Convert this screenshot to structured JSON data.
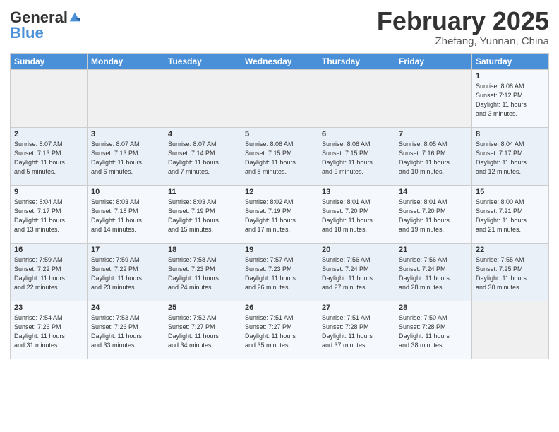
{
  "header": {
    "logo_general": "General",
    "logo_blue": "Blue",
    "month_title": "February 2025",
    "location": "Zhefang, Yunnan, China"
  },
  "days_of_week": [
    "Sunday",
    "Monday",
    "Tuesday",
    "Wednesday",
    "Thursday",
    "Friday",
    "Saturday"
  ],
  "weeks": [
    [
      {
        "day": "",
        "info": ""
      },
      {
        "day": "",
        "info": ""
      },
      {
        "day": "",
        "info": ""
      },
      {
        "day": "",
        "info": ""
      },
      {
        "day": "",
        "info": ""
      },
      {
        "day": "",
        "info": ""
      },
      {
        "day": "1",
        "info": "Sunrise: 8:08 AM\nSunset: 7:12 PM\nDaylight: 11 hours\nand 3 minutes."
      }
    ],
    [
      {
        "day": "2",
        "info": "Sunrise: 8:07 AM\nSunset: 7:13 PM\nDaylight: 11 hours\nand 5 minutes."
      },
      {
        "day": "3",
        "info": "Sunrise: 8:07 AM\nSunset: 7:13 PM\nDaylight: 11 hours\nand 6 minutes."
      },
      {
        "day": "4",
        "info": "Sunrise: 8:07 AM\nSunset: 7:14 PM\nDaylight: 11 hours\nand 7 minutes."
      },
      {
        "day": "5",
        "info": "Sunrise: 8:06 AM\nSunset: 7:15 PM\nDaylight: 11 hours\nand 8 minutes."
      },
      {
        "day": "6",
        "info": "Sunrise: 8:06 AM\nSunset: 7:15 PM\nDaylight: 11 hours\nand 9 minutes."
      },
      {
        "day": "7",
        "info": "Sunrise: 8:05 AM\nSunset: 7:16 PM\nDaylight: 11 hours\nand 10 minutes."
      },
      {
        "day": "8",
        "info": "Sunrise: 8:04 AM\nSunset: 7:17 PM\nDaylight: 11 hours\nand 12 minutes."
      }
    ],
    [
      {
        "day": "9",
        "info": "Sunrise: 8:04 AM\nSunset: 7:17 PM\nDaylight: 11 hours\nand 13 minutes."
      },
      {
        "day": "10",
        "info": "Sunrise: 8:03 AM\nSunset: 7:18 PM\nDaylight: 11 hours\nand 14 minutes."
      },
      {
        "day": "11",
        "info": "Sunrise: 8:03 AM\nSunset: 7:19 PM\nDaylight: 11 hours\nand 15 minutes."
      },
      {
        "day": "12",
        "info": "Sunrise: 8:02 AM\nSunset: 7:19 PM\nDaylight: 11 hours\nand 17 minutes."
      },
      {
        "day": "13",
        "info": "Sunrise: 8:01 AM\nSunset: 7:20 PM\nDaylight: 11 hours\nand 18 minutes."
      },
      {
        "day": "14",
        "info": "Sunrise: 8:01 AM\nSunset: 7:20 PM\nDaylight: 11 hours\nand 19 minutes."
      },
      {
        "day": "15",
        "info": "Sunrise: 8:00 AM\nSunset: 7:21 PM\nDaylight: 11 hours\nand 21 minutes."
      }
    ],
    [
      {
        "day": "16",
        "info": "Sunrise: 7:59 AM\nSunset: 7:22 PM\nDaylight: 11 hours\nand 22 minutes."
      },
      {
        "day": "17",
        "info": "Sunrise: 7:59 AM\nSunset: 7:22 PM\nDaylight: 11 hours\nand 23 minutes."
      },
      {
        "day": "18",
        "info": "Sunrise: 7:58 AM\nSunset: 7:23 PM\nDaylight: 11 hours\nand 24 minutes."
      },
      {
        "day": "19",
        "info": "Sunrise: 7:57 AM\nSunset: 7:23 PM\nDaylight: 11 hours\nand 26 minutes."
      },
      {
        "day": "20",
        "info": "Sunrise: 7:56 AM\nSunset: 7:24 PM\nDaylight: 11 hours\nand 27 minutes."
      },
      {
        "day": "21",
        "info": "Sunrise: 7:56 AM\nSunset: 7:24 PM\nDaylight: 11 hours\nand 28 minutes."
      },
      {
        "day": "22",
        "info": "Sunrise: 7:55 AM\nSunset: 7:25 PM\nDaylight: 11 hours\nand 30 minutes."
      }
    ],
    [
      {
        "day": "23",
        "info": "Sunrise: 7:54 AM\nSunset: 7:26 PM\nDaylight: 11 hours\nand 31 minutes."
      },
      {
        "day": "24",
        "info": "Sunrise: 7:53 AM\nSunset: 7:26 PM\nDaylight: 11 hours\nand 33 minutes."
      },
      {
        "day": "25",
        "info": "Sunrise: 7:52 AM\nSunset: 7:27 PM\nDaylight: 11 hours\nand 34 minutes."
      },
      {
        "day": "26",
        "info": "Sunrise: 7:51 AM\nSunset: 7:27 PM\nDaylight: 11 hours\nand 35 minutes."
      },
      {
        "day": "27",
        "info": "Sunrise: 7:51 AM\nSunset: 7:28 PM\nDaylight: 11 hours\nand 37 minutes."
      },
      {
        "day": "28",
        "info": "Sunrise: 7:50 AM\nSunset: 7:28 PM\nDaylight: 11 hours\nand 38 minutes."
      },
      {
        "day": "",
        "info": ""
      }
    ]
  ]
}
